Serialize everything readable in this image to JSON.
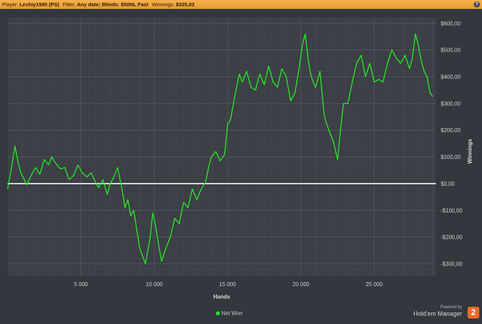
{
  "header": {
    "player_label": "Player:",
    "player_value": "Leshiy1990 (PS)",
    "filter_label": "Filter:",
    "filter_value": "Any date; Blinds: $50NL Fast",
    "winnings_label": "Winnings:",
    "winnings_value": "$325,02",
    "help_glyph": "?"
  },
  "legend": {
    "label": "Net Won",
    "color": "#25e625"
  },
  "branding": {
    "powered_by": "Powered by",
    "product": "Hold'em Manager",
    "logo_text": "2"
  },
  "chart_data": {
    "type": "line",
    "title": "",
    "xlabel": "Hands",
    "ylabel": "Winnings",
    "xlim": [
      0,
      29200
    ],
    "ylim": [
      -345,
      620
    ],
    "x_ticks": [
      5000,
      10000,
      15000,
      20000,
      25000
    ],
    "x_tick_labels": [
      "5 000",
      "10 000",
      "15 000",
      "20 000",
      "25 000"
    ],
    "y_ticks": [
      600,
      500,
      400,
      300,
      200,
      100,
      0,
      -100,
      -200,
      -300
    ],
    "y_tick_labels": [
      "$600,00",
      "$500,00",
      "$400,00",
      "$300,00",
      "$200,00",
      "$100,00",
      "$0,00",
      "-$100,00",
      "-$200,00",
      "-$300,00"
    ],
    "grid": true,
    "legend_position": "bottom",
    "series": [
      {
        "name": "Net Won",
        "color": "#25e625",
        "x": [
          0,
          300,
          500,
          700,
          900,
          1100,
          1300,
          1600,
          1900,
          2200,
          2500,
          2800,
          3000,
          3300,
          3600,
          3900,
          4200,
          4500,
          4800,
          5100,
          5400,
          5700,
          6000,
          6200,
          6500,
          6800,
          7000,
          7200,
          7500,
          7800,
          8000,
          8200,
          8400,
          8600,
          8800,
          9000,
          9200,
          9400,
          9700,
          9900,
          10100,
          10300,
          10500,
          10800,
          11100,
          11400,
          11700,
          12000,
          12300,
          12600,
          12900,
          13200,
          13500,
          13700,
          13900,
          14200,
          14500,
          14800,
          15000,
          15200,
          15500,
          15800,
          16000,
          16300,
          16600,
          16900,
          17200,
          17500,
          17800,
          18100,
          18400,
          18700,
          19000,
          19300,
          19600,
          19900,
          20100,
          20300,
          20500,
          20700,
          21000,
          21300,
          21600,
          21900,
          22200,
          22500,
          22700,
          22900,
          23200,
          23500,
          23800,
          24100,
          24400,
          24700,
          25000,
          25300,
          25600,
          25900,
          26200,
          26500,
          26800,
          27100,
          27400,
          27600,
          27800,
          28000,
          28200,
          28400,
          28600,
          28800,
          29000
        ],
        "y": [
          -20,
          70,
          140,
          85,
          40,
          20,
          -5,
          30,
          60,
          35,
          90,
          70,
          100,
          75,
          55,
          60,
          15,
          30,
          70,
          40,
          25,
          40,
          5,
          -15,
          15,
          -40,
          0,
          20,
          60,
          -20,
          -90,
          -60,
          -120,
          -100,
          -170,
          -240,
          -270,
          -300,
          -210,
          -110,
          -160,
          -230,
          -290,
          -240,
          -200,
          -130,
          -150,
          -70,
          -90,
          -20,
          -60,
          -20,
          5,
          60,
          100,
          120,
          85,
          110,
          220,
          240,
          330,
          410,
          380,
          420,
          360,
          350,
          410,
          370,
          440,
          380,
          360,
          430,
          400,
          310,
          340,
          440,
          520,
          560,
          460,
          400,
          360,
          420,
          250,
          200,
          160,
          90,
          200,
          300,
          300,
          380,
          450,
          480,
          400,
          450,
          380,
          390,
          380,
          450,
          500,
          470,
          450,
          480,
          430,
          470,
          560,
          520,
          460,
          420,
          400,
          340,
          325
        ]
      }
    ]
  }
}
